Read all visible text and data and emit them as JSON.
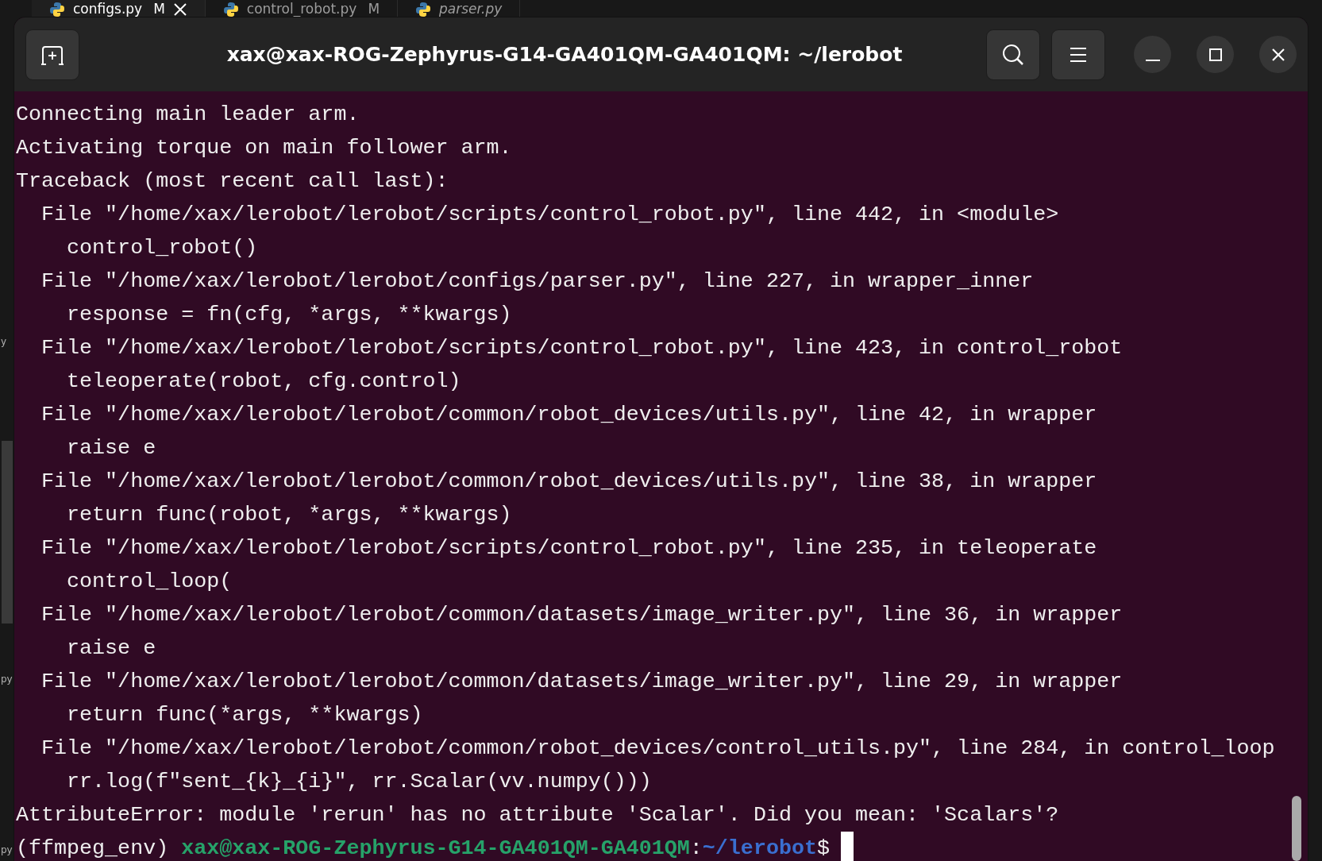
{
  "editor_tabs": [
    {
      "name": "configs.py",
      "badge": "M",
      "selected": true,
      "preview": false
    },
    {
      "name": "control_robot.py",
      "badge": "M",
      "selected": false,
      "preview": false
    },
    {
      "name": "parser.py",
      "selected": false,
      "preview": true
    }
  ],
  "editor_gutter": [
    "y",
    "py",
    "py"
  ],
  "window": {
    "title": "xax@xax-ROG-Zephyrus-G14-GA401QM-GA401QM: ~/lerobot"
  },
  "terminal_lines": [
    {
      "kind": "plain",
      "text": "Connecting main leader arm."
    },
    {
      "kind": "plain",
      "text": "Activating torque on main follower arm."
    },
    {
      "kind": "plain",
      "text": "Traceback (most recent call last):"
    },
    {
      "kind": "plain",
      "text": "  File \"/home/xax/lerobot/lerobot/scripts/control_robot.py\", line 442, in <module>"
    },
    {
      "kind": "plain",
      "text": "    control_robot()"
    },
    {
      "kind": "plain",
      "text": "  File \"/home/xax/lerobot/lerobot/configs/parser.py\", line 227, in wrapper_inner"
    },
    {
      "kind": "plain",
      "text": "    response = fn(cfg, *args, **kwargs)"
    },
    {
      "kind": "plain",
      "text": "  File \"/home/xax/lerobot/lerobot/scripts/control_robot.py\", line 423, in control_robot"
    },
    {
      "kind": "plain",
      "text": "    teleoperate(robot, cfg.control)"
    },
    {
      "kind": "plain",
      "text": "  File \"/home/xax/lerobot/lerobot/common/robot_devices/utils.py\", line 42, in wrapper"
    },
    {
      "kind": "plain",
      "text": "    raise e"
    },
    {
      "kind": "plain",
      "text": "  File \"/home/xax/lerobot/lerobot/common/robot_devices/utils.py\", line 38, in wrapper"
    },
    {
      "kind": "plain",
      "text": "    return func(robot, *args, **kwargs)"
    },
    {
      "kind": "plain",
      "text": "  File \"/home/xax/lerobot/lerobot/scripts/control_robot.py\", line 235, in teleoperate"
    },
    {
      "kind": "plain",
      "text": "    control_loop("
    },
    {
      "kind": "plain",
      "text": "  File \"/home/xax/lerobot/lerobot/common/datasets/image_writer.py\", line 36, in wrapper"
    },
    {
      "kind": "plain",
      "text": "    raise e"
    },
    {
      "kind": "plain",
      "text": "  File \"/home/xax/lerobot/lerobot/common/datasets/image_writer.py\", line 29, in wrapper"
    },
    {
      "kind": "plain",
      "text": "    return func(*args, **kwargs)"
    },
    {
      "kind": "plain",
      "text": "  File \"/home/xax/lerobot/lerobot/common/robot_devices/control_utils.py\", line 284, in control_loop"
    },
    {
      "kind": "plain",
      "text": "    rr.log(f\"sent_{k}_{i}\", rr.Scalar(vv.numpy()))"
    },
    {
      "kind": "plain",
      "text": "AttributeError: module 'rerun' has no attribute 'Scalar'. Did you mean: 'Scalars'?"
    },
    {
      "kind": "prompt",
      "env": "(ffmpeg_env)",
      "user_host": "xax@xax-ROG-Zephyrus-G14-GA401QM-GA401QM",
      "separator": ":",
      "path": "~/lerobot",
      "symbol": "$"
    }
  ]
}
